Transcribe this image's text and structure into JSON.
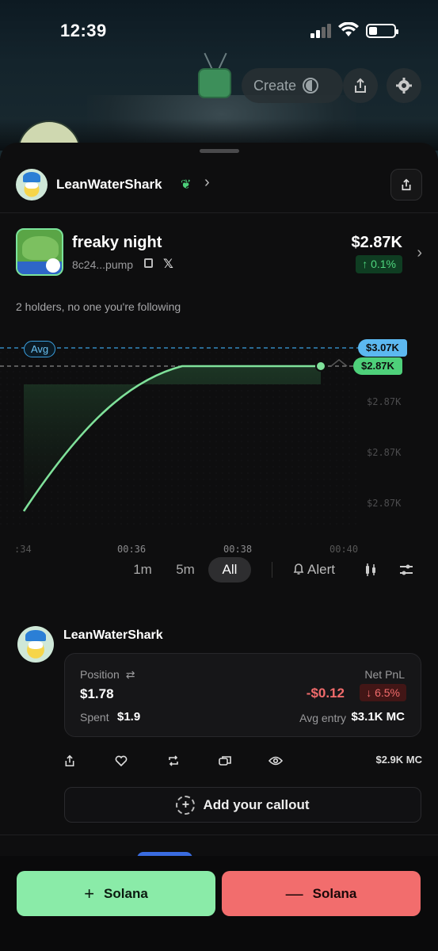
{
  "status_bar": {
    "time": "12:39"
  },
  "top_bar": {
    "create_label": "Create"
  },
  "creator": {
    "name": "LeanWaterShark"
  },
  "token": {
    "name": "freaky night",
    "address": "8c24...pump",
    "price": "$2.87K",
    "change": "↑ 0.1%",
    "holders_text": "2 holders, no one you're following"
  },
  "chart_data": {
    "type": "line",
    "x_labels": [
      ":34",
      "00:36",
      "00:38",
      "00:40"
    ],
    "y_labels": [
      "$2.87K",
      "$2.87K",
      "$2.87K"
    ],
    "avg_label": "Avg",
    "avg_price": "$3.07K",
    "current_price": "$2.87K",
    "colors": {
      "line": "#7fe19a",
      "avg": "#3aa0e0",
      "current": "#4ed07a"
    }
  },
  "ranges": {
    "r1": "1m",
    "r2": "5m",
    "r3": "All",
    "selected": "All"
  },
  "alert_label": "Alert",
  "position": {
    "user": "LeanWaterShark",
    "position_label": "Position",
    "position_value": "$1.78",
    "spent_label": "Spent",
    "spent_value": "$1.9",
    "pnl_label": "Net PnL",
    "pnl_value": "-$0.12",
    "pnl_pct": "↓ 6.5%",
    "avg_entry_label": "Avg entry",
    "avg_entry_value": "$3.1K MC",
    "mc": "$2.9K  MC"
  },
  "callout_label": "Add your callout",
  "trade": {
    "buy_label": "Solana",
    "sell_label": "Solana",
    "buy_symbol": "+",
    "sell_symbol": "—"
  }
}
